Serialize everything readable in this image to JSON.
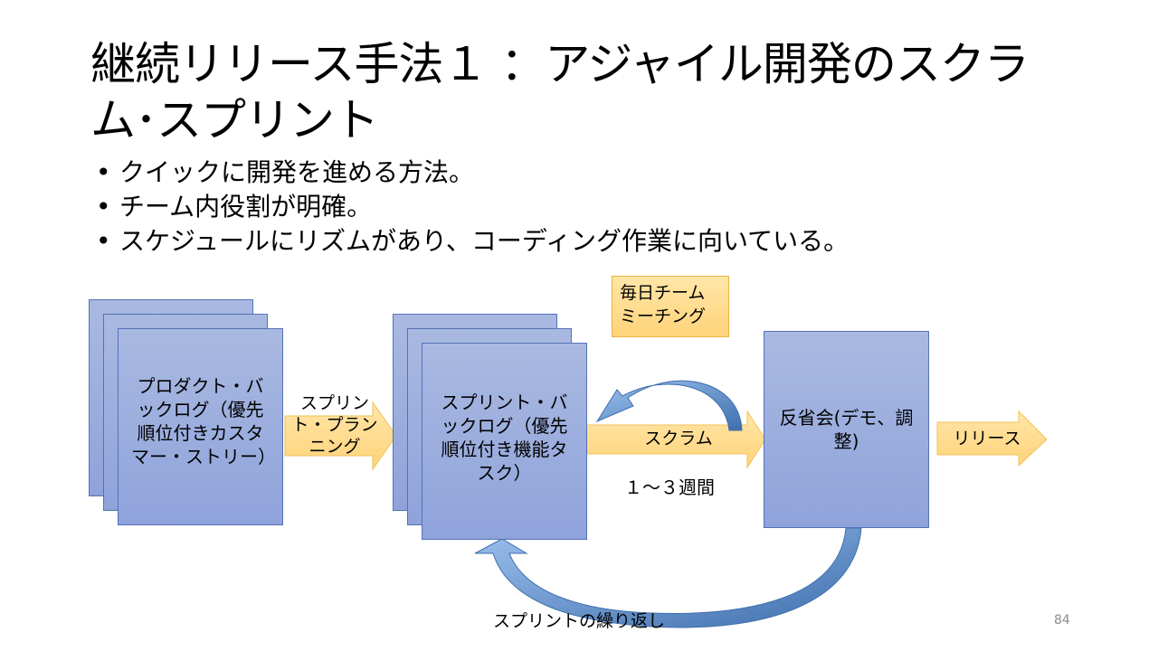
{
  "slide": {
    "title": "継続リリース手法１ ：アジャイル開発のスクラム･スプリント",
    "bullets": [
      "クイックに開発を進める方法。",
      "チーム内役割が明確。",
      "スケジュールにリズムがあり、コーディング作業に向いている。"
    ],
    "bullet_glyph": "•",
    "page_number": "84"
  },
  "diagram": {
    "product_backlog": "プロダクト・バックログ（優先順位付きカスタマー・ストリー）",
    "sprint_planning": "スプリント・プランニング",
    "sprint_backlog": "スプリント・バックログ（優先順位付き機能タスク）",
    "daily_meeting": "毎日チームミーチング",
    "scrum": "スクラム",
    "duration": "１～３週間",
    "retrospective": "反省会(デモ、調整)",
    "release": "リリース",
    "sprint_repeat": "スプリントの繰り返し",
    "colors": {
      "box": "#8fa3db",
      "box_border": "#5471b8",
      "arrow_yellow": "#ffd37a",
      "arrow_blue": "#4a7fc1"
    }
  }
}
